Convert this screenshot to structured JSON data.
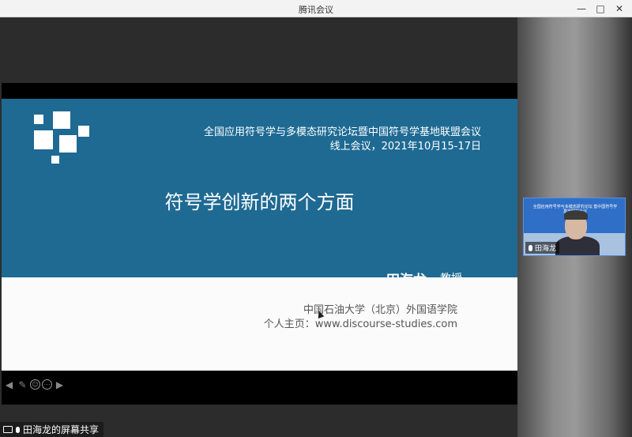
{
  "window": {
    "title": "腾讯会议",
    "minimize_glyph": "—",
    "maximize_glyph": "□",
    "close_glyph": "✕"
  },
  "slide": {
    "conference_line1": "全国应用符号学与多模态研究论坛暨中国符号学基地联盟会议",
    "conference_line2": "线上会议，2021年10月15-17日",
    "title": "符号学创新的两个方面",
    "speaker_name": "田海龙",
    "speaker_title": "教授",
    "affiliation": "中国石油大学（北京）外国语学院",
    "homepage": "个人主页：www.discourse-studies.com",
    "colors": {
      "blue": "#1e6a93",
      "white": "#fbfbfb"
    }
  },
  "slide_toolbar": {
    "prev_icon": "arrow-left-icon",
    "pen_icon": "pen-icon",
    "emoji_icon": "emoji-icon",
    "more_icon": "more-icon",
    "next_icon": "arrow-right-icon"
  },
  "participant_video": {
    "name": "田海龙",
    "background_text": "全国应用符号学与多模态研究论坛 暨中国符号学基地联盟会议"
  },
  "share_badge": {
    "label": "田海龙的屏幕共享"
  }
}
